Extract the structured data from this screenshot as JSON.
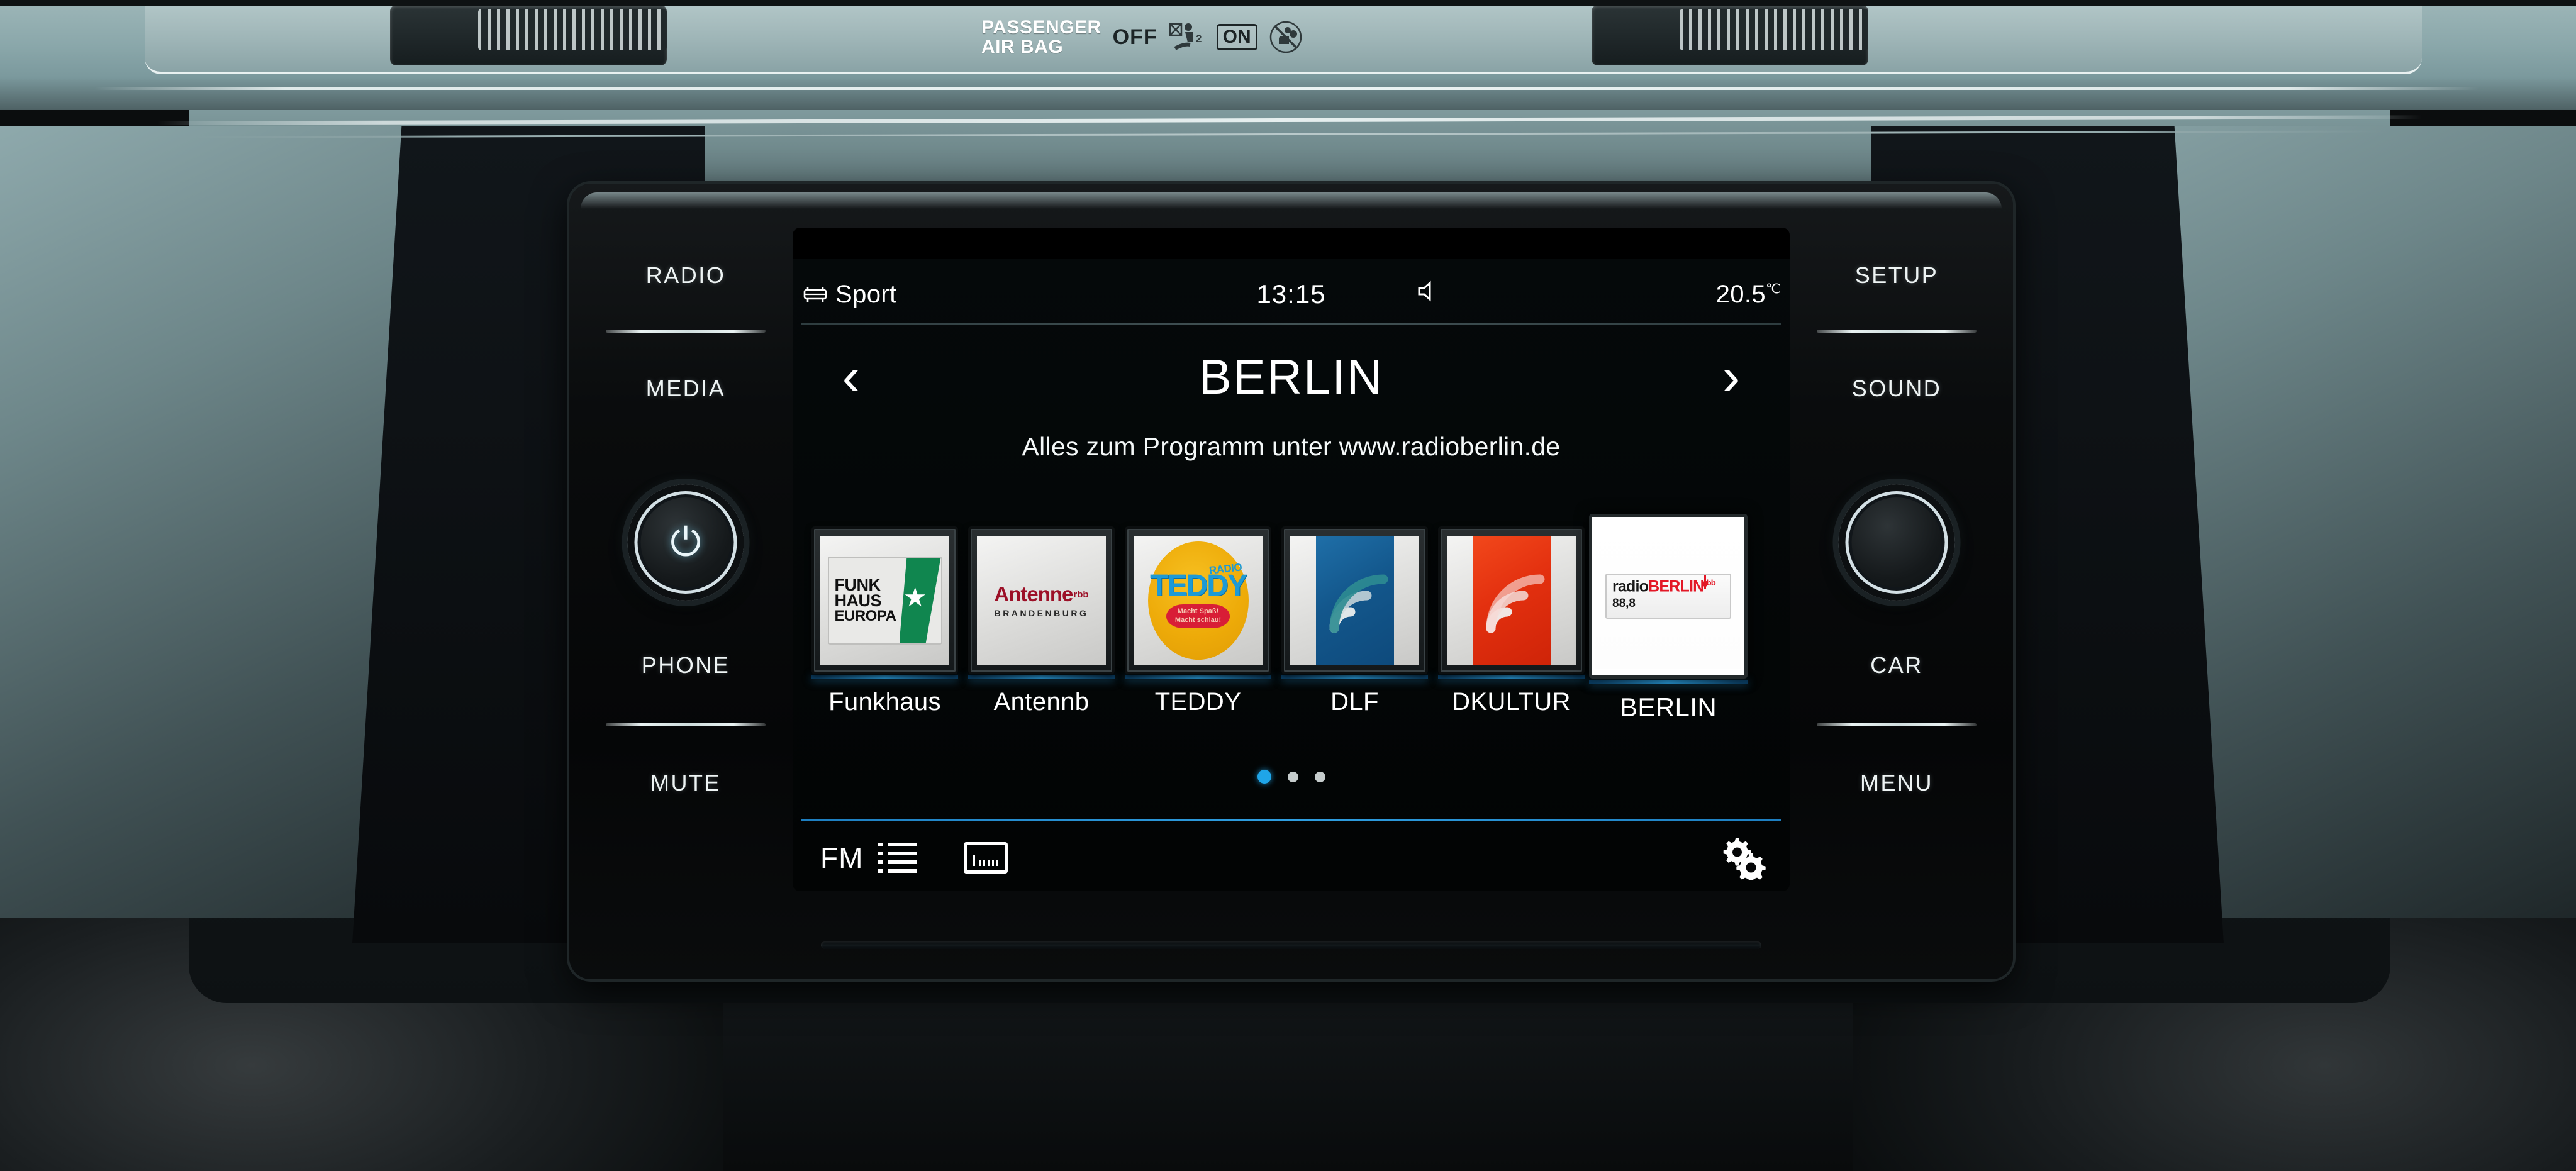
{
  "airbag": {
    "label_line1": "PASSENGER",
    "label_line2": "AIR BAG",
    "off_text": "OFF",
    "on_text": "ON",
    "off_icon": "seat-belt-child-crossed-icon",
    "on_icon": "airbag-disabled-icon"
  },
  "hardware": {
    "left": [
      {
        "label": "RADIO"
      },
      {
        "label": "MEDIA"
      },
      {
        "label": "PHONE"
      },
      {
        "label": "MUTE"
      }
    ],
    "right": [
      {
        "label": "SETUP"
      },
      {
        "label": "SOUND"
      },
      {
        "label": "CAR"
      },
      {
        "label": "MENU"
      }
    ],
    "left_knob": {
      "icon": "power-icon",
      "glyph": "⏻"
    },
    "right_knob": {
      "icon": "tune-knob-icon"
    }
  },
  "statusbar": {
    "drive_mode_icon": "car-icon",
    "drive_mode": "Sport",
    "clock": "13:15",
    "speaker_icon": "speaker-icon",
    "temperature": "20.5",
    "temperature_unit": "℃"
  },
  "station_header": {
    "prev_icon": "chevron-left-icon",
    "prev_glyph": "‹",
    "station_name": "BERLIN",
    "next_icon": "chevron-right-icon",
    "next_glyph": "›"
  },
  "radio_text": "Alles zum Programm unter www.radioberlin.de",
  "presets": [
    {
      "label": "Funkhaus",
      "logo_type": "funkhaus",
      "logo_lines": [
        "FUNK",
        "HAUS",
        "EUROPA"
      ],
      "accent": "#10864f",
      "selected": false
    },
    {
      "label": "Antennb",
      "logo_type": "antenne",
      "logo_main": "Antenne",
      "logo_super": "rbb",
      "logo_sub": "BRANDENBURG",
      "accent": "#9c1027",
      "selected": false
    },
    {
      "label": "TEDDY",
      "logo_type": "teddy",
      "logo_top": "RADIO",
      "logo_main": "TEDDY",
      "logo_tagline1": "Macht Spaß!",
      "logo_tagline2": "Macht schlau!",
      "accent": "#f0b10c",
      "selected": false
    },
    {
      "label": "DLF",
      "logo_type": "waves-blue",
      "accent": "#13578c",
      "selected": false
    },
    {
      "label": "DKULTUR",
      "logo_type": "waves-red",
      "accent": "#e3300f",
      "selected": false
    },
    {
      "label": "BERLIN",
      "logo_type": "radioberlin",
      "logo_word1": "radio",
      "logo_word2": "BERLIN",
      "logo_super": "rbb",
      "logo_freq": "88,8",
      "accent": "#e31827",
      "selected": true
    }
  ],
  "pagination": {
    "total": 3,
    "active_index": 0,
    "active_color": "#1fa5e8"
  },
  "toolbar": {
    "band_label": "FM",
    "list_icon": "list-icon",
    "tune_icon": "manual-tune-icon",
    "settings_icon": "gears-icon"
  }
}
